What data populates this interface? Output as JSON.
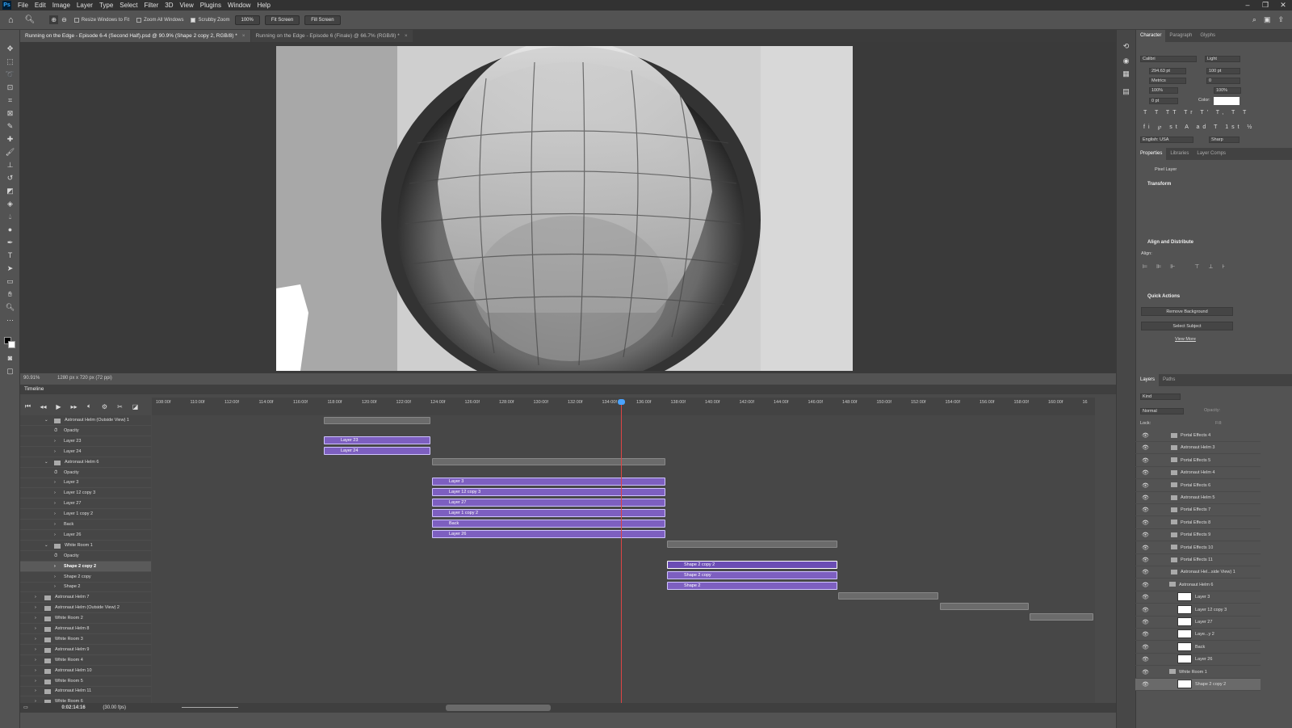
{
  "app": {
    "logo": "Ps",
    "menu": [
      "File",
      "Edit",
      "Image",
      "Layer",
      "Type",
      "Select",
      "Filter",
      "3D",
      "View",
      "Plugins",
      "Window",
      "Help"
    ]
  },
  "options": {
    "resize_windows": "Resize Windows to Fit",
    "zoom_all": "Zoom All Windows",
    "scrubby": "Scrubby Zoom",
    "zoom_value": "100%",
    "fit_screen": "Fit Screen",
    "fill_screen": "Fill Screen"
  },
  "doc_tabs": [
    {
      "label": "Running on the Edge - Episode 6-4 (Second Half).psd @ 90.9% (Shape 2 copy 2, RGB/8) *"
    },
    {
      "label": "Running on the Edge - Episode 6 (Finale) @ 66.7% (RGB/8) *"
    }
  ],
  "status": {
    "zoom": "90.91%",
    "size": "1280 px x 720 px (72 ppi)"
  },
  "timeline": {
    "title": "Timeline",
    "time": "0:02:14:16",
    "fps": "(30.00 fps)",
    "ticks": [
      "108:00f",
      "110:00f",
      "112:00f",
      "114:00f",
      "116:00f",
      "118:00f",
      "120:00f",
      "122:00f",
      "124:00f",
      "126:00f",
      "128:00f",
      "130:00f",
      "132:00f",
      "134:00f",
      "136:00f",
      "138:00f",
      "140:00f",
      "142:00f",
      "144:00f",
      "146:00f",
      "148:00f",
      "150:00f",
      "152:00f",
      "154:00f",
      "156:00f",
      "158:00f",
      "160:00f",
      "16"
    ],
    "layers": [
      "Astronaut Helm (Outside View) 1",
      "Opacity",
      "Layer 23",
      "Layer 24",
      "Astronaut Helm 6",
      "Opacity",
      "Layer 3",
      "Layer 12 copy 3",
      "Layer 27",
      "Layer 1 copy 2",
      "Back",
      "Layer 26",
      "White Room 1",
      "Opacity",
      "Shape 2 copy 2",
      "Shape 2 copy",
      "Shape 2",
      "Astronaut Helm 7",
      "Astronaut Helm (Outside View) 2",
      "White Room 2",
      "Astronaut Helm 8",
      "White Room 3",
      "Astronaut Helm 9",
      "White Room 4",
      "Astronaut Helm 10",
      "White Room 5",
      "Astronaut Helm 11",
      "White Room 6"
    ],
    "clips": {
      "c1": "Layer 23",
      "c2": "Layer 24",
      "c3": "Layer 3",
      "c4": "Layer 12 copy 3",
      "c5": "Layer 27",
      "c6": "Layer 1 copy 2",
      "c7": "Back",
      "c8": "Layer 26",
      "c9": "Shape 2 copy 2",
      "c10": "Shape 2 copy",
      "c11": "Shape 2"
    }
  },
  "character": {
    "tabs": [
      "Character",
      "Paragraph",
      "Glyphs"
    ],
    "font": "Calibri",
    "style": "Light",
    "size": "294.63 pt",
    "leading": "100 pt",
    "kerning": "Metrics",
    "tracking": "0",
    "vscale": "100%",
    "hscale": "100%",
    "baseline": "0 pt",
    "color_label": "Color:",
    "language": "English: USA",
    "aa": "Sharp"
  },
  "properties": {
    "tabs": [
      "Properties",
      "Libraries",
      "Layer Comps"
    ],
    "kind": "Pixel Layer",
    "transform": "Transform",
    "align_title": "Align and Distribute",
    "align_label": "Align:",
    "quick_actions": "Quick Actions",
    "remove_bg": "Remove Background",
    "select_subject": "Select Subject",
    "view_more": "View More"
  },
  "layers_panel": {
    "tabs": [
      "Layers",
      "Paths"
    ],
    "kind": "Kind",
    "mode": "Normal",
    "opacity_label": "Opacity:",
    "lock_label": "Lock:",
    "fill_label": "Fill:",
    "items": [
      "Portal Effects 4",
      "Astronaut Helm 3",
      "Portal Effects 5",
      "Astronaut Helm 4",
      "Portal Effects 6",
      "Astronaut Helm 5",
      "Portal Effects 7",
      "Portal Effects 8",
      "Portal Effects 9",
      "Portal Effects 10",
      "Portal Effects 11",
      "Astronaut Hel...side View) 1",
      "Astronaut Helm 6",
      "Layer 3",
      "Layer 12 copy 3",
      "Layer 27",
      "Laye...y 2",
      "Back",
      "Layer 26",
      "White Room 1",
      "Shape 2 copy 2"
    ]
  }
}
